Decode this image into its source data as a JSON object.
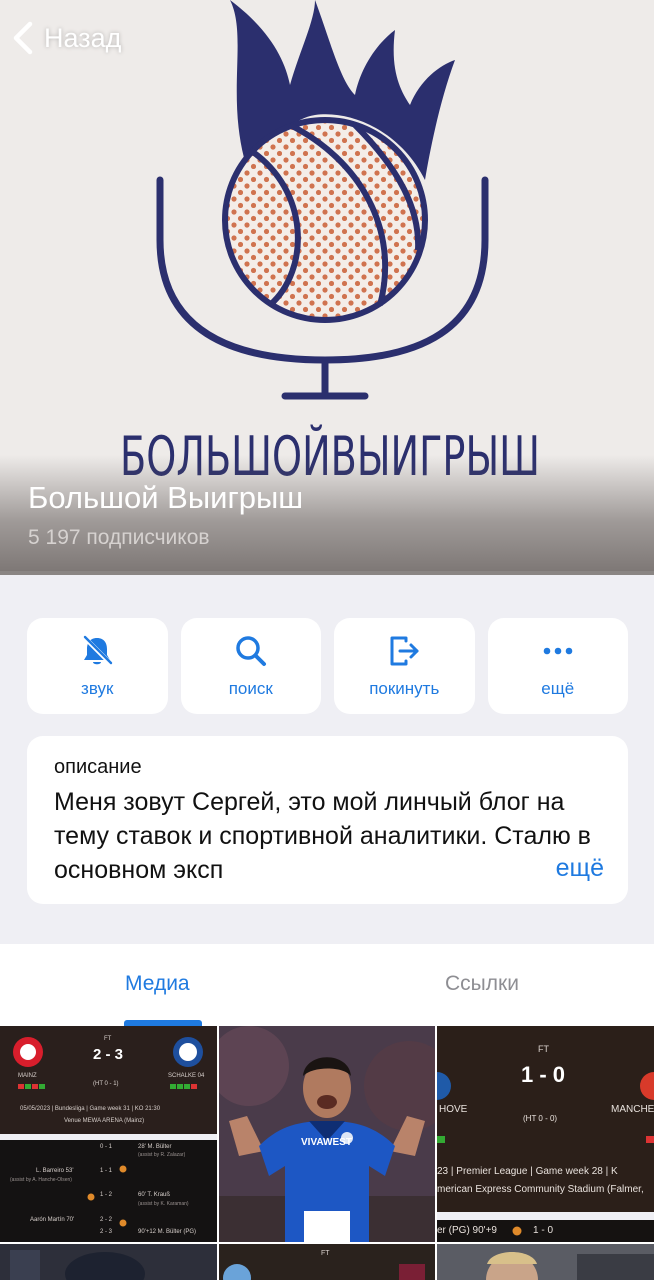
{
  "header": {
    "back_label": "Назад",
    "logo_wordmark": "БОЛЬШОЙВЫИГРЫШ",
    "channel_title": "Большой Выигрыш",
    "subscribers": "5 197 подписчиков"
  },
  "actions": [
    {
      "label": "звук",
      "icon": "bell-slash-icon"
    },
    {
      "label": "поиск",
      "icon": "search-icon"
    },
    {
      "label": "покинуть",
      "icon": "leave-icon"
    },
    {
      "label": "ещё",
      "icon": "ellipsis-icon"
    }
  ],
  "description": {
    "heading": "описание",
    "text": "Меня зовут Сергей, это мой линчый блог на тему ставок и спортивной аналитики. Сталю в основном эксп",
    "more_label": "ещё"
  },
  "tabs": [
    {
      "label": "Медиа",
      "active": true
    },
    {
      "label": "Ссылки",
      "active": false
    }
  ],
  "media": {
    "tile1": {
      "status": "FT",
      "score": "2 - 3",
      "home": "MAINZ",
      "away": "SCHALKE 04",
      "ht": "(HT 0 - 1)",
      "meta": "05/05/2023 | Bundesliga | Game week 31 | KO 21:30",
      "venue": "Venue MEWA ARENA (Mainz)",
      "events": [
        {
          "left": "",
          "score": "0 - 1",
          "right": "28' M. Bülter",
          "assist": "(assist by R. Zalazar)"
        },
        {
          "left": "L. Barreiro 53'",
          "score": "1 - 1",
          "right": "",
          "assist": "(assist by A. Hanche-Olsen)"
        },
        {
          "left": "",
          "score": "1 - 2",
          "right": "60' T. Krauß",
          "assist": "(assist by K. Karaman)"
        },
        {
          "left": "Aarón Martín 70'",
          "score": "2 - 2",
          "right": "",
          "assist": ""
        },
        {
          "left": "",
          "score": "2 - 3",
          "right": "90'+12 M. Bülter (PG)",
          "assist": ""
        }
      ]
    },
    "tile2": {
      "shirt_text": "VIVAWEST"
    },
    "tile3": {
      "status": "FT",
      "score": "1 - 0",
      "home": "HOVE",
      "away": "MANCHE",
      "ht": "(HT 0 - 0)",
      "meta": "23 | Premier League | Game week 28 | K",
      "venue": "merican Express Community Stadium (Falmer, ",
      "event": "er (PG) 90'+9",
      "event_score": "1 - 0"
    },
    "tile5": {
      "status": "FT"
    }
  },
  "colors": {
    "accent": "#1f7ae0",
    "logo_navy": "#2b2f6e",
    "ball_dots": "#d0734f",
    "card_bg": "#ffffff",
    "page_bg": "#efeff4"
  }
}
